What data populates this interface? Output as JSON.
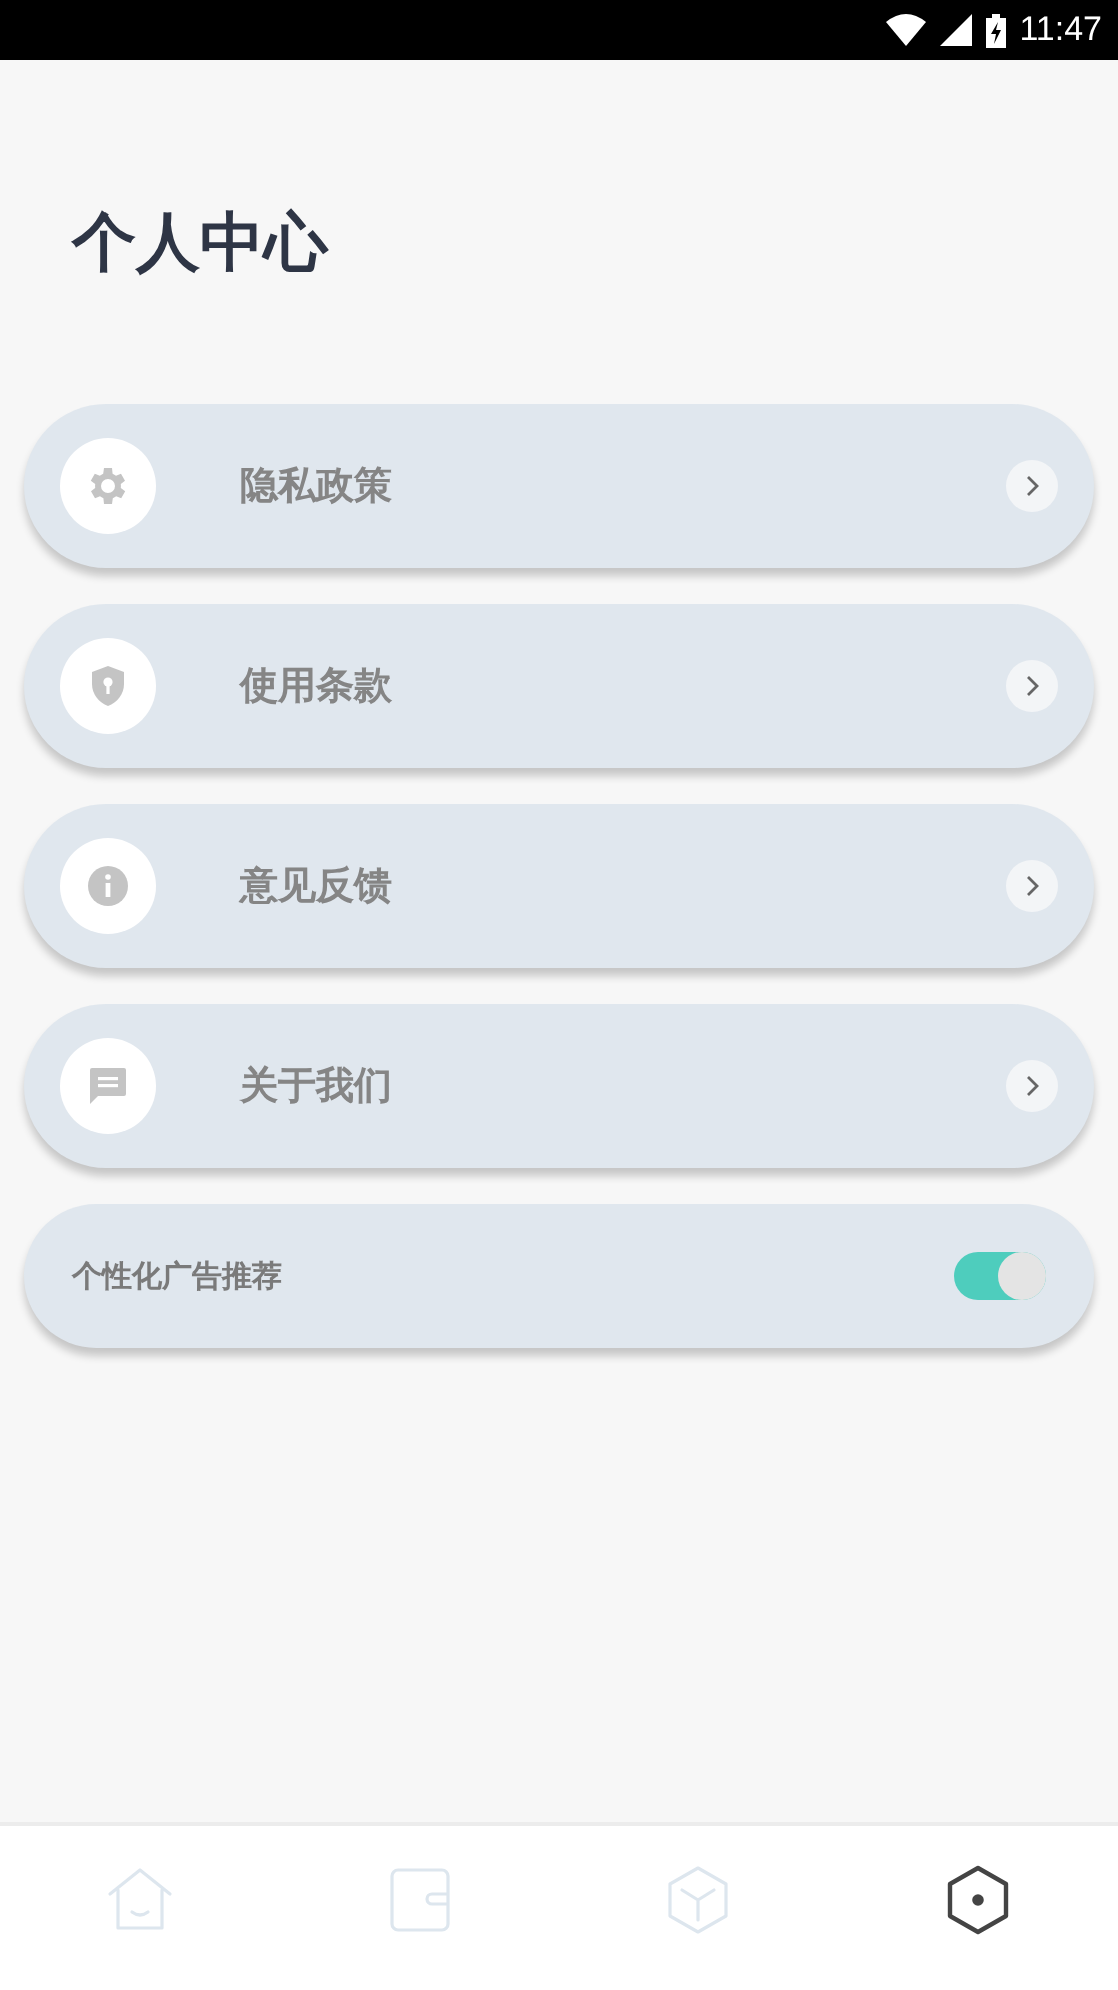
{
  "status_bar": {
    "time": "11:47"
  },
  "title": "个人中心",
  "menu": [
    {
      "label": "隐私政策"
    },
    {
      "label": "使用条款"
    },
    {
      "label": "意见反馈"
    },
    {
      "label": "关于我们"
    }
  ],
  "ad_setting": {
    "label": "个性化广告推荐",
    "on": true
  },
  "bottom_nav": [
    {
      "selected": false
    },
    {
      "selected": false
    },
    {
      "selected": false
    },
    {
      "selected": true
    }
  ]
}
